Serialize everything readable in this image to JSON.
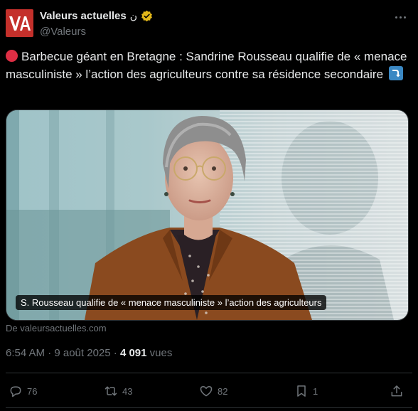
{
  "author": {
    "name": "Valeurs actuelles",
    "name_extra": "ن",
    "handle": "@Valeurs",
    "logo_text": "VA"
  },
  "tweet": {
    "text": "Barbecue géant en Bretagne : Sandrine Rousseau qualifie de « menace masculiniste » l’action des agriculteurs contre sa résidence secondaire"
  },
  "media": {
    "caption": "S. Rousseau qualifie de « menace masculiniste » l’action des agriculteurs",
    "source": "De valeursactuelles.com"
  },
  "meta": {
    "time": "6:54 AM · 9 août 2025 · ",
    "views_count": "4 091",
    "views_label": " vues"
  },
  "actions": {
    "replies": "76",
    "reposts": "43",
    "likes": "82",
    "bookmarks": "1"
  },
  "icons": {
    "avatar": "valeurs-actuelles-logo",
    "verified": "verified-gold-badge-icon",
    "more": "more-icon",
    "emoji_1": "red-circle-emoji",
    "emoji_2": "right-arrow-curving-down-emoji",
    "reply": "reply-icon",
    "repost": "repost-icon",
    "like": "heart-icon",
    "bookmark": "bookmark-icon",
    "share": "share-icon"
  },
  "colors": {
    "background": "#000000",
    "text": "#e7e9ea",
    "secondary": "#71767b",
    "brand": "#c4302b",
    "verified": "#e2b719"
  }
}
